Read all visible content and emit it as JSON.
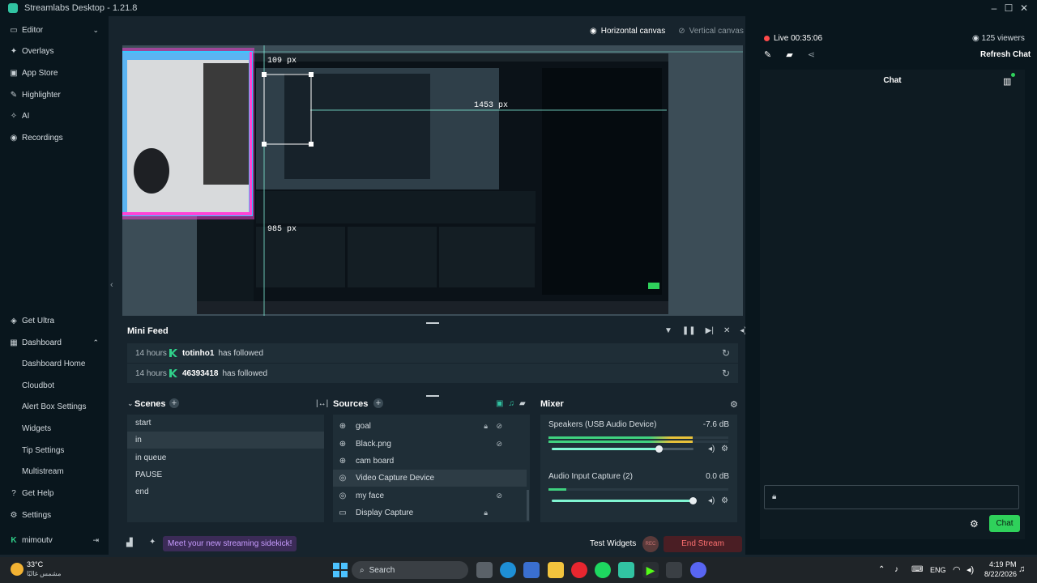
{
  "window": {
    "title": "Streamlabs Desktop - 1.21.8"
  },
  "sidebar": {
    "top_items": [
      {
        "label": "Editor",
        "icon": "editor-icon"
      },
      {
        "label": "Overlays",
        "icon": "overlays-icon"
      },
      {
        "label": "App Store",
        "icon": "app-store-icon"
      },
      {
        "label": "Highlighter",
        "icon": "highlighter-icon"
      },
      {
        "label": "AI",
        "icon": "ai-icon"
      },
      {
        "label": "Recordings",
        "icon": "record-icon"
      }
    ],
    "get_ultra": "Get Ultra",
    "dashboard": "Dashboard",
    "dashboard_items": [
      "Dashboard Home",
      "Cloudbot",
      "Alert Box Settings",
      "Widgets",
      "Tip Settings",
      "Multistream"
    ],
    "get_help": "Get Help",
    "settings": "Settings",
    "user": "mimoutv"
  },
  "canvas": {
    "horizontal": "Horizontal canvas",
    "vertical": "Vertical canvas",
    "measure_top": "109 px",
    "measure_right": "1453 px",
    "measure_bottom": "985 px"
  },
  "minifeed": {
    "title": "Mini Feed",
    "events": [
      {
        "time": "14 hours",
        "user": "totinho1",
        "action": "has followed"
      },
      {
        "time": "14 hours",
        "user": "46393418",
        "action": "has followed"
      }
    ]
  },
  "scenes": {
    "title": "Scenes",
    "items": [
      "start",
      "in",
      "in queue",
      "PAUSE",
      "end"
    ],
    "selected": 1
  },
  "sources": {
    "title": "Sources",
    "items": [
      {
        "name": "goal",
        "icon": "globe-icon"
      },
      {
        "name": "Black.png",
        "icon": "globe-icon"
      },
      {
        "name": "cam board",
        "icon": "globe-icon"
      },
      {
        "name": "Video Capture Device",
        "icon": "webcam-icon"
      },
      {
        "name": "my face",
        "icon": "webcam-icon"
      },
      {
        "name": "Display Capture",
        "icon": "monitor-icon"
      }
    ]
  },
  "mixer": {
    "title": "Mixer",
    "channels": [
      {
        "name": "Speakers (USB Audio Device)",
        "db": "-7.6 dB",
        "level": 0.8,
        "volume": 0.76
      },
      {
        "name": "Audio Input Capture (2)",
        "db": "0.0 dB",
        "level": 0.1,
        "volume": 1.0
      }
    ]
  },
  "footer": {
    "sidekick": "Meet your new streaming sidekick!",
    "test_widgets": "Test Widgets",
    "rec": "REC",
    "end_stream": "End Stream"
  },
  "chat": {
    "live": "Live 00:35:06",
    "viewers": "125 viewers",
    "refresh": "Refresh Chat",
    "title": "Chat",
    "send": "Chat"
  },
  "taskbar": {
    "weather_temp": "33°C",
    "weather_desc": "مشمس غالبًا",
    "search": "Search",
    "lang": "ENG",
    "time": "4:19 PM",
    "date": "8/22/2026"
  }
}
